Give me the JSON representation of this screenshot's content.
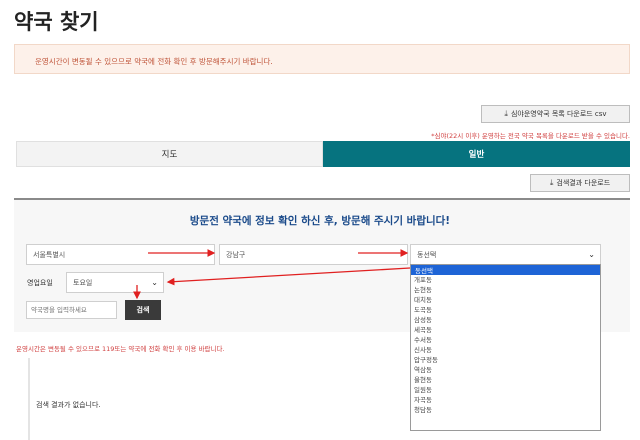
{
  "page": {
    "title": "약국 찾기"
  },
  "notice": {
    "text": "운영시간이 변동될 수 있으므로 약국에 전화 확인 후 방문해주시기 바랍니다."
  },
  "csv_button": {
    "label": "심야운영약국 목록 다운로드 csv"
  },
  "hint": {
    "text": "*심야(22시 이후) 운영하는 전국 약국 목록을 다운로드 받을 수 있습니다."
  },
  "tabs": [
    {
      "label": "지도",
      "active": false
    },
    {
      "label": "일반",
      "active": true
    }
  ],
  "result_download": {
    "label": "검색결과 다운로드"
  },
  "search": {
    "heading": "방문전 약국에 정보 확인 하신 후, 방문해 주시기 바랍니다!",
    "city": "서울특별시",
    "district": "강남구",
    "dong": "동선택",
    "biz_label": "영업요일",
    "day": "토요일",
    "placeholder": "약국명을 입력하세요",
    "button": "검색"
  },
  "warning": {
    "text": "운영시간은 변동될 수 있으므로 119또는 약국에 전화 확인 후 이용 바랍니다."
  },
  "results": {
    "empty_text": "검색 결과가 없습니다."
  },
  "dong_options": [
    "동선택",
    "개포동",
    "논현동",
    "대치동",
    "도곡동",
    "삼성동",
    "세곡동",
    "수서동",
    "신사동",
    "압구정동",
    "역삼동",
    "율현동",
    "일원동",
    "자곡동",
    "청담동"
  ],
  "colors": {
    "accent": "#06737f",
    "arrow": "#e02020",
    "notice_text": "#c0553a",
    "heading": "#1a4a8a"
  }
}
